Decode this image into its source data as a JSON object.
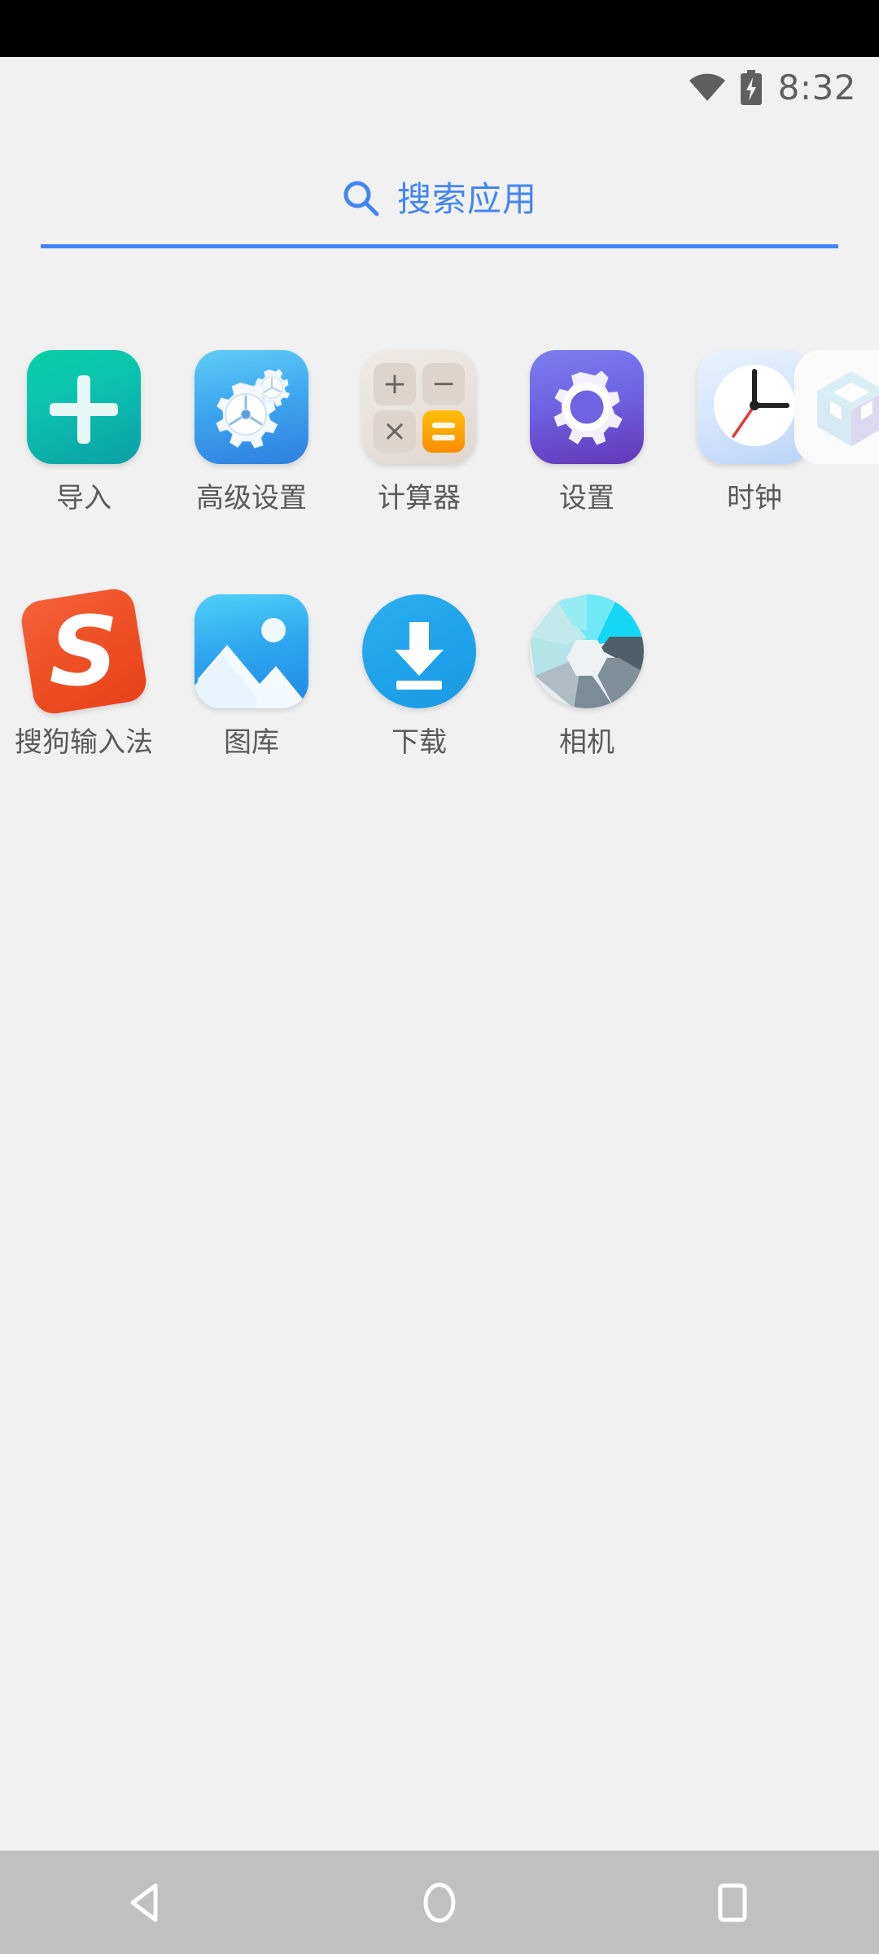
{
  "status_bar": {
    "time": "8:32",
    "wifi_icon": "wifi-icon",
    "battery_icon": "battery-charging-icon",
    "icon_color": "#5f5f5f"
  },
  "search": {
    "placeholder": "搜索应用",
    "icon": "search-icon",
    "accent_color": "#4285f4"
  },
  "theme": {
    "background": "#f1f1f1",
    "label_color": "#5a5a5a",
    "navbar_background": "#c0c0c0",
    "notch_color": "#000000"
  },
  "app_grid": {
    "rows": [
      {
        "apps": [
          {
            "label": "导入",
            "icon": "import-plus-icon"
          },
          {
            "label": "高级设置",
            "icon": "advanced-settings-gears-icon"
          },
          {
            "label": "计算器",
            "icon": "calculator-icon"
          },
          {
            "label": "设置",
            "icon": "settings-gear-icon"
          },
          {
            "label": "时钟",
            "icon": "clock-icon"
          }
        ],
        "partial_app": {
          "label": "",
          "icon": "cube-icon"
        }
      },
      {
        "apps": [
          {
            "label": "搜狗输入法",
            "icon": "sogou-input-icon"
          },
          {
            "label": "图库",
            "icon": "gallery-icon"
          },
          {
            "label": "下载",
            "icon": "download-icon"
          },
          {
            "label": "相机",
            "icon": "camera-aperture-icon"
          }
        ]
      }
    ]
  },
  "calculator_icon": {
    "keys": [
      "+",
      "−",
      "×",
      "="
    ]
  },
  "nav_bar": {
    "back_label": "back-button",
    "home_label": "home-button",
    "recents_label": "recents-button"
  }
}
